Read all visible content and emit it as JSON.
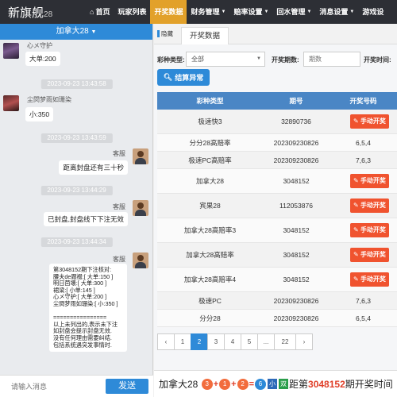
{
  "app": {
    "logo": "新旗舰",
    "logo_num": "28"
  },
  "nav": [
    {
      "label": "首页",
      "icon": "home-icon"
    },
    {
      "label": "玩家列表"
    },
    {
      "label": "开奖数据",
      "active": true
    },
    {
      "label": "财务管理",
      "caret": true
    },
    {
      "label": "赔率设置",
      "caret": true
    },
    {
      "label": "回水管理",
      "caret": true
    },
    {
      "label": "消息设置",
      "caret": true
    },
    {
      "label": "游戏设"
    }
  ],
  "chat": {
    "room": "加拿大28",
    "messages": {
      "m1": {
        "name": "心メ守护",
        "text": "大单:200"
      },
      "t1": "2023-09-23 13:43:58",
      "m2": {
        "name": "尘焛梦雨如珊染",
        "text": "小:350"
      },
      "t2": "2023-09-23 13:43:59",
      "m3": {
        "name": "客服",
        "text": "距离封盘还有三十秒"
      },
      "t3": "2023-09-23 13:44:29",
      "m4": {
        "name": "客服",
        "text": "已封盘,封盘线下下注无效"
      },
      "t4": "2023-09-23 13:44:34",
      "m5": {
        "name": "客服",
        "text": "第3048152期下注核对:\n腰夫de厰裰:[ 大单:150 ]\n明日茴壊:[ 大单:300 ]\n裙梁:[ 小单:145 ]\n心メ守护:[ 大单:200 ]\n尘焛梦雨如珊染:[ 小:350 ]\n\n================\n以上未列出的,表示未下注\n如封盘会提示封盘无效.\n没有任何理由需要纠结.\n包括系统遇突发事情时."
      }
    },
    "input_placeholder": "请输入消息",
    "send_label": "发送"
  },
  "main": {
    "hide_label": "隐藏",
    "tab_label": "开奖数据",
    "filters": {
      "type_label": "彩种类型:",
      "type_value": "全部",
      "issue_label": "开奖期数:",
      "issue_placeholder": "期数",
      "time_label": "开奖时间:"
    },
    "settle_label": "结算异常",
    "table": {
      "headers": [
        "彩种类型",
        "期号",
        "开奖号码"
      ],
      "rows": [
        {
          "type": "极速快3",
          "issue": "32890736",
          "result": "",
          "action": "手动开奖"
        },
        {
          "type": "分分28高赔率",
          "issue": "202309230826",
          "result": "6,5,4",
          "action": ""
        },
        {
          "type": "极速PC高赔率",
          "issue": "202309230826",
          "result": "7,6,3",
          "action": ""
        },
        {
          "type": "加拿大28",
          "issue": "3048152",
          "result": "",
          "action": "手动开奖"
        },
        {
          "type": "宾果28",
          "issue": "112053876",
          "result": "",
          "action": "手动开奖"
        },
        {
          "type": "加拿大28高赔率3",
          "issue": "3048152",
          "result": "",
          "action": "手动开奖"
        },
        {
          "type": "加拿大28高赔率",
          "issue": "3048152",
          "result": "",
          "action": "手动开奖"
        },
        {
          "type": "加拿大28高赔率4",
          "issue": "3048152",
          "result": "",
          "action": "手动开奖"
        },
        {
          "type": "极速PC",
          "issue": "202309230826",
          "result": "7,6,3",
          "action": ""
        },
        {
          "type": "分分28",
          "issue": "202309230826",
          "result": "6,5,4",
          "action": ""
        }
      ]
    },
    "pager": [
      "‹",
      "1",
      "2",
      "3",
      "4",
      "5",
      "...",
      "22",
      "›"
    ],
    "pager_active": "2",
    "ticker": {
      "game": "加拿大28",
      "b1": "3",
      "plus1": "+",
      "b2": "1",
      "plus2": "+",
      "b3": "2",
      "eq": "=",
      "b4": "6",
      "tag1": "小",
      "tag2": "双",
      "pre": "距第",
      "issue": "3048152",
      "post": "期开奖时间"
    }
  }
}
